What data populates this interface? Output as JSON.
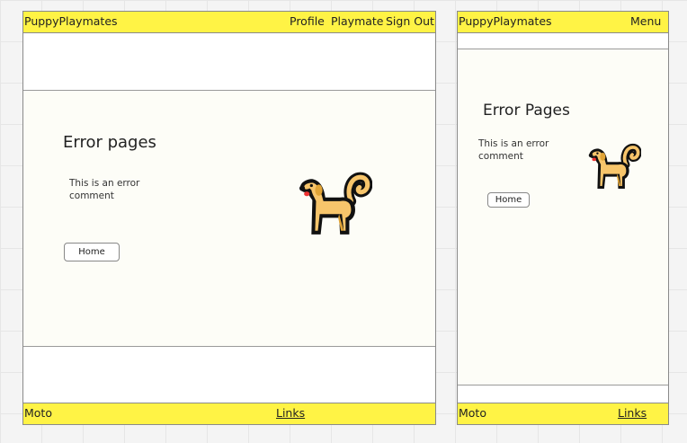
{
  "desktop": {
    "brand": "PuppyPlaymates",
    "nav": [
      "Profile",
      "Playmate",
      "Sign Out"
    ],
    "heading": "Error pages",
    "comment_line1": "This is an error",
    "comment_line2": "comment",
    "home_label": "Home",
    "footer_brand": "Moto",
    "footer_link": "Links"
  },
  "mobile": {
    "brand": "PuppyPlaymates",
    "menu_label": "Menu",
    "heading": "Error Pages",
    "comment_line1": "This is an error",
    "comment_line2": "comment",
    "home_label": "Home",
    "footer_brand": "Moto",
    "footer_link": "Links"
  },
  "colors": {
    "accent_yellow": "#fff345",
    "content_bg": "#fdfdf7",
    "frame_border": "#8a8a8a"
  },
  "icons": {
    "dog": "dog-icon"
  }
}
